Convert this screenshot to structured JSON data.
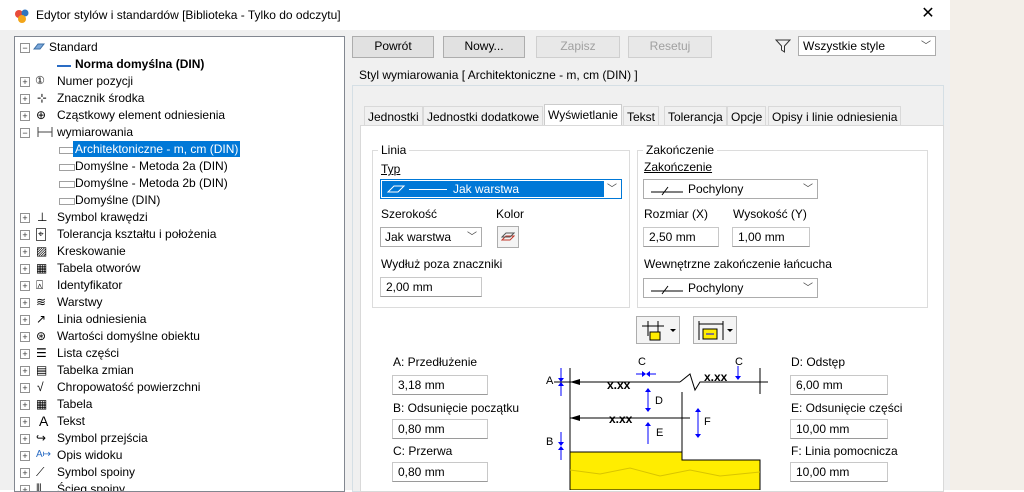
{
  "window": {
    "title": "Edytor stylów i standardów [Biblioteka - Tylko do odczytu]",
    "close_glyph": "✕"
  },
  "tree": {
    "root": "Standard",
    "items": [
      {
        "label": "Norma domyślna (DIN)",
        "bold": true
      },
      {
        "label": "Numer pozycji"
      },
      {
        "label": "Znacznik środka"
      },
      {
        "label": "Cząstkowy element odniesienia"
      },
      {
        "label": "wymiarowania"
      },
      {
        "label": "Architektoniczne - m, cm (DIN)",
        "selected": true
      },
      {
        "label": "Domyślne - Metoda 2a (DIN)"
      },
      {
        "label": "Domyślne - Metoda 2b (DIN)"
      },
      {
        "label": "Domyślne (DIN)"
      },
      {
        "label": "Symbol krawędzi"
      },
      {
        "label": "Tolerancja kształtu i położenia"
      },
      {
        "label": "Kreskowanie"
      },
      {
        "label": "Tabela otworów"
      },
      {
        "label": "Identyfikator"
      },
      {
        "label": "Warstwy"
      },
      {
        "label": "Linia odniesienia"
      },
      {
        "label": "Wartości domyślne obiektu"
      },
      {
        "label": "Lista części"
      },
      {
        "label": "Tabelka zmian"
      },
      {
        "label": "Chropowatość powierzchni"
      },
      {
        "label": "Tabela"
      },
      {
        "label": "Tekst"
      },
      {
        "label": "Symbol przejścia"
      },
      {
        "label": "Opis widoku"
      },
      {
        "label": "Symbol spoiny"
      },
      {
        "label": "Ścieg spoiny"
      }
    ]
  },
  "toolbar": {
    "back": "Powrót",
    "new": "Nowy...",
    "save": "Zapisz",
    "reset": "Resetuj",
    "filter": "Wszystkie style"
  },
  "style_header": "Styl wymiarowania [ Architektoniczne - m, cm (DIN) ]",
  "tabs": [
    "Jednostki",
    "Jednostki dodatkowe",
    "Wyświetlanie",
    "Tekst",
    "Tolerancja",
    "Opcje",
    "Opisy i linie odniesienia"
  ],
  "active_tab": "Wyświetlanie",
  "linia": {
    "group": "Linia",
    "type_label": "Typ",
    "type_value": "Jak warstwa",
    "width_label": "Szerokość",
    "width_value": "Jak warstwa",
    "color_label": "Kolor",
    "extend_label": "Wydłuż poza znaczniki",
    "extend_value": "2,00 mm"
  },
  "zakonczenie": {
    "group": "Zakończenie",
    "end_label": "Zakończenie",
    "end_value": "Pochylony",
    "size_x_label": "Rozmiar (X)",
    "size_x_value": "2,50 mm",
    "height_y_label": "Wysokość (Y)",
    "height_y_value": "1,00 mm",
    "inner_label": "Wewnętrzne zakończenie łańcucha",
    "inner_value": "Pochylony"
  },
  "params_left": [
    {
      "label": "A: Przedłużenie",
      "value": "3,18 mm"
    },
    {
      "label": "B: Odsunięcie początku",
      "value": "0,80 mm"
    },
    {
      "label": "C: Przerwa",
      "value": "0,80 mm"
    }
  ],
  "params_right": [
    {
      "label": "D: Odstęp",
      "value": "6,00 mm"
    },
    {
      "label": "E: Odsunięcie części",
      "value": "10,00 mm"
    },
    {
      "label": "F: Linia pomocnicza",
      "value": "10,00 mm"
    }
  ],
  "diagram": {
    "labels": [
      "A",
      "B",
      "C",
      "C",
      "D",
      "E",
      "F"
    ],
    "dim_text": "x.xx",
    "colors": {
      "part_fill": "#ffed00",
      "arrow": "#0000ff"
    }
  }
}
